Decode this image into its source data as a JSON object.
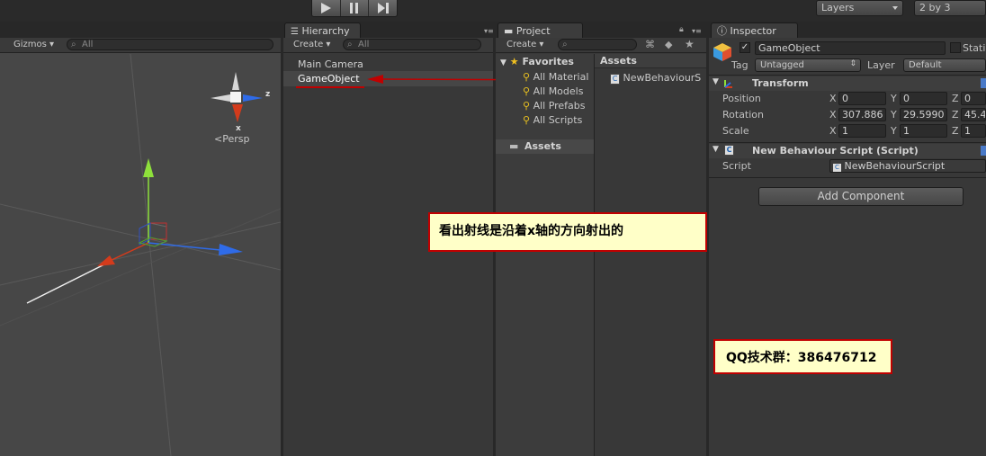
{
  "toolbar": {
    "layers_label": "Layers",
    "layout_label": "2 by 3"
  },
  "scene": {
    "gizmos_label": "Gizmos",
    "search_placeholder": "All",
    "gizmo_axis_z": "z",
    "gizmo_axis_x": "x",
    "persp_label": "Persp"
  },
  "hierarchy": {
    "tab_label": "Hierarchy",
    "create_label": "Create",
    "search_placeholder": "All",
    "items": [
      {
        "label": "Main Camera"
      },
      {
        "label": "GameObject"
      }
    ]
  },
  "project": {
    "tab_label": "Project",
    "create_label": "Create",
    "favorites_label": "Favorites",
    "favorites": [
      {
        "label": "All Material"
      },
      {
        "label": "All Models"
      },
      {
        "label": "All Prefabs"
      },
      {
        "label": "All Scripts"
      }
    ],
    "assets_tree_label": "Assets",
    "assets_header": "Assets",
    "asset_items": [
      {
        "label": "NewBehaviourS"
      }
    ]
  },
  "inspector": {
    "tab_label": "Inspector",
    "object_name": "GameObject",
    "static_label": "Static",
    "tag_label": "Tag",
    "tag_value": "Untagged",
    "layer_label": "Layer",
    "layer_value": "Default",
    "transform": {
      "title": "Transform",
      "rows": [
        {
          "label": "Position",
          "x": "0",
          "y": "0",
          "z": "0"
        },
        {
          "label": "Rotation",
          "x": "307.886",
          "y": "29.5990",
          "z": "45.4"
        },
        {
          "label": "Scale",
          "x": "1",
          "y": "1",
          "z": "1"
        }
      ],
      "axis_x": "X",
      "axis_y": "Y",
      "axis_z": "Z"
    },
    "script_component": {
      "title": "New Behaviour Script (Script)",
      "script_label": "Script",
      "script_value": "NewBehaviourScript"
    },
    "add_component_label": "Add Component"
  },
  "annotations": {
    "ray_note": "看出射线是沿着x轴的方向射出的",
    "qq_note": "QQ技术群：386476712"
  },
  "colors": {
    "accent_red": "#c00000",
    "callout_bg": "#ffffc8",
    "gizmo_x": "#d33b1c",
    "gizmo_y": "#8ee03b",
    "gizmo_z": "#2f6be8"
  }
}
